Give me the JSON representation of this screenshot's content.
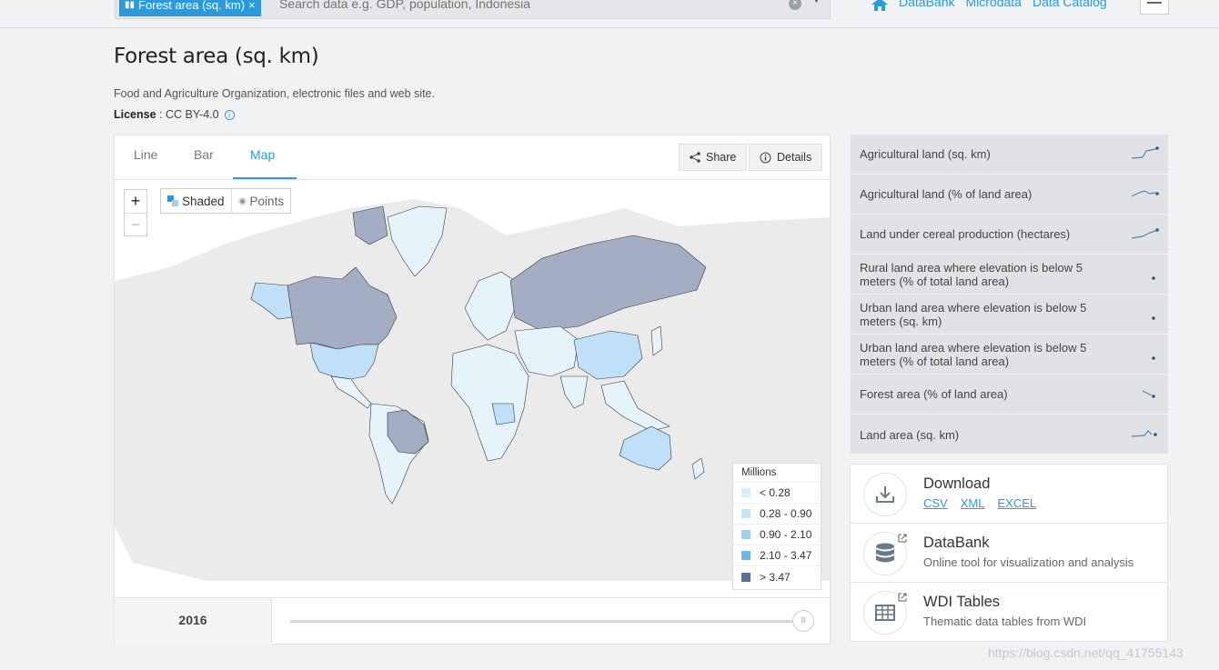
{
  "search": {
    "chip_label": "Forest area (sq. km)",
    "placeholder": "Search data e.g. GDP, population, Indonesia"
  },
  "top_nav": {
    "links": [
      "DataBank",
      "Microdata",
      "Data Catalog"
    ]
  },
  "page": {
    "title": "Forest area (sq. km)",
    "source": "Food and Agriculture Organization, electronic files and web site.",
    "license_label": "License",
    "license_value": " : CC BY-4.0"
  },
  "tabs": [
    "Line",
    "Bar",
    "Map"
  ],
  "active_tab": "Map",
  "actions": {
    "share": "Share",
    "details": "Details"
  },
  "map": {
    "zoom_in": "+",
    "zoom_out": "−",
    "modes": [
      "Shaded",
      "Points"
    ],
    "legend": {
      "title": "Millions",
      "items": [
        {
          "label": "< 0.28",
          "color": "#d8eefb"
        },
        {
          "label": "0.28 - 0.90",
          "color": "#c5e4f7"
        },
        {
          "label": "0.90 - 2.10",
          "color": "#9fd0f0"
        },
        {
          "label": "2.10 - 3.47",
          "color": "#6fb7e8"
        },
        {
          "label": "> 3.47",
          "color": "#55709c"
        }
      ]
    }
  },
  "timeline": {
    "year": "2016"
  },
  "related": [
    "Agricultural land (sq. km)",
    "Agricultural land (% of land area)",
    "Land under cereal production (hectares)",
    "Rural land area where elevation is below 5 meters (% of total land area)",
    "Urban land area where elevation is below 5 meters (sq. km)",
    "Urban land area where elevation is below 5 meters (% of total land area)",
    "Forest area (% of land area)",
    "Land area (sq. km)"
  ],
  "downloads": {
    "download_title": "Download",
    "formats": [
      "CSV",
      "XML",
      "EXCEL"
    ],
    "databank_title": "DataBank",
    "databank_sub": "Online tool for visualization and analysis",
    "wdi_title": "WDI Tables",
    "wdi_sub": "Thematic data tables from WDI"
  },
  "watermark": "https://blog.csdn.net/qq_41755143",
  "colors": {
    "accent": "#2a99dd",
    "map_dark": "#a3aec4",
    "map_light": "#e5f3fb",
    "map_mid": "#bfe0f8"
  }
}
